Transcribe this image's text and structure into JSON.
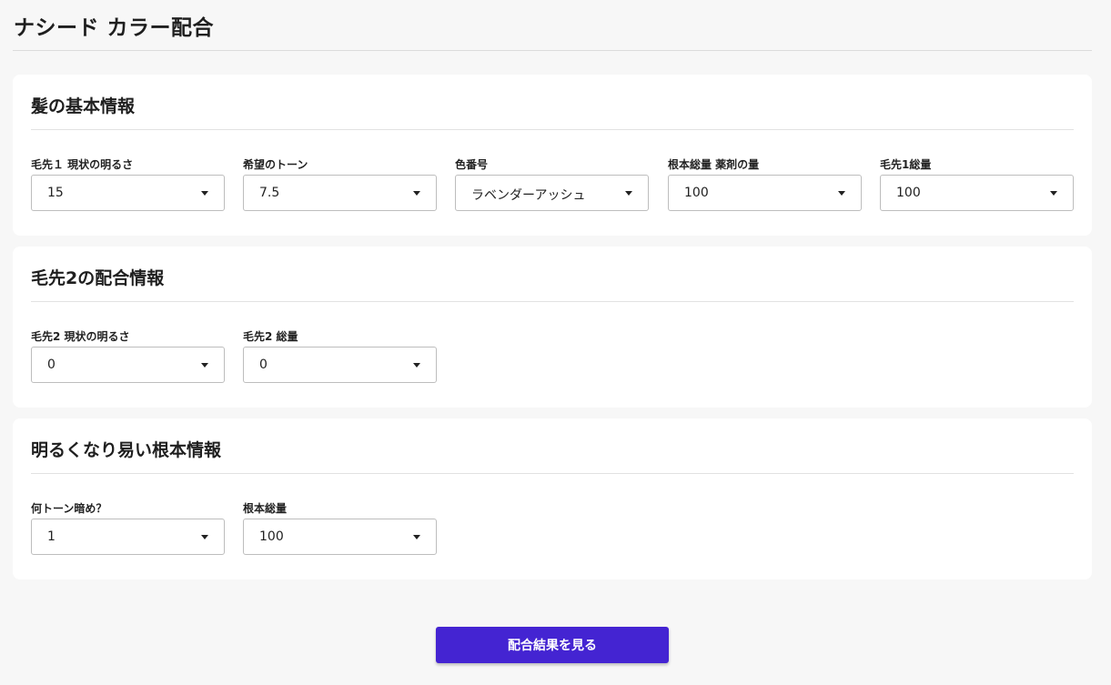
{
  "page": {
    "title": "ナシード カラー配合"
  },
  "sections": [
    {
      "heading": "髪の基本情報",
      "fields": [
        {
          "label": "毛先１ 現状の明るさ",
          "value": "15"
        },
        {
          "label": "希望のトーン",
          "value": "7.5"
        },
        {
          "label": "色番号",
          "value": "ラベンダーアッシュ"
        },
        {
          "label": "根本総量 薬剤の量",
          "value": "100"
        },
        {
          "label": "毛先1総量",
          "value": "100"
        }
      ]
    },
    {
      "heading": "毛先2の配合情報",
      "fields": [
        {
          "label": "毛先2 現状の明るさ",
          "value": "0"
        },
        {
          "label": "毛先2 総量",
          "value": "0"
        }
      ]
    },
    {
      "heading": "明るくなり易い根本情報",
      "fields": [
        {
          "label": "何トーン暗め？",
          "value": "1"
        },
        {
          "label": "根本総量",
          "value": "100"
        }
      ]
    }
  ],
  "submit": {
    "label": "配合結果を見る"
  },
  "colors": {
    "background": "#f7f7f7",
    "card": "#ffffff",
    "accent": "#4424d2"
  },
  "icons": {
    "dropdown": "caret-down-icon"
  }
}
